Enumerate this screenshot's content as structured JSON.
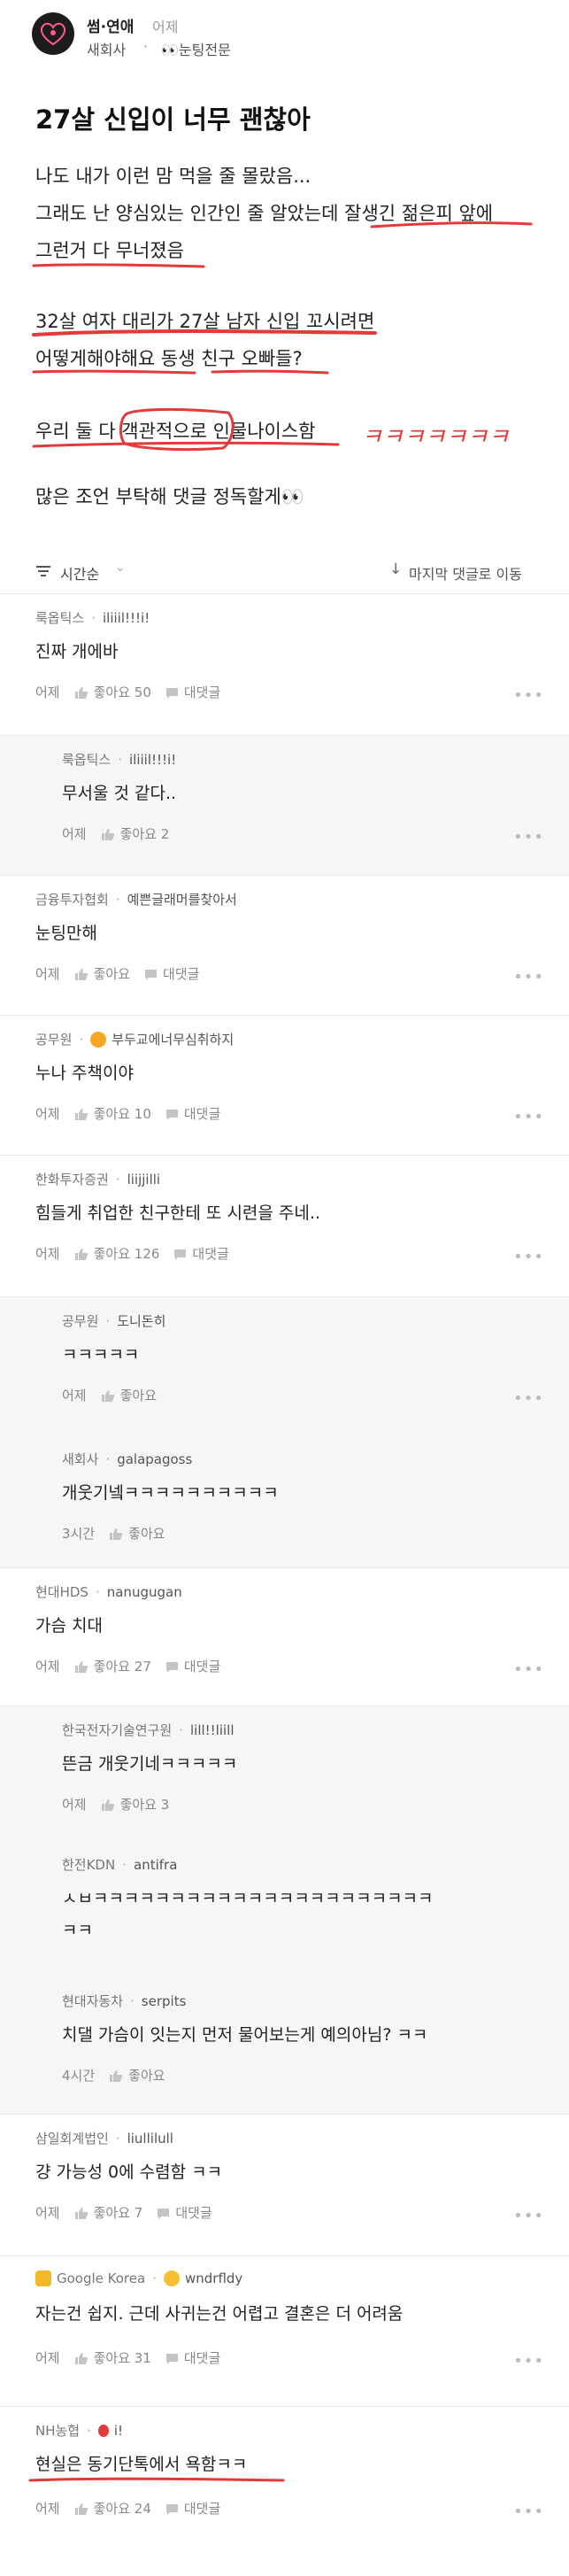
{
  "header": {
    "board_name": "썸·연애",
    "post_time": "어제",
    "author_company": "새회사",
    "author_dot": "·",
    "author_nick": "👀눈팅전문"
  },
  "post": {
    "title": "27살 신입이 너무 괜찮아",
    "lines": [
      "나도 내가 이런 맘 먹을 줄 몰랐음...",
      "그래도 난 양심있는 인간인 줄 알았는데 잘생긴 젊은피 앞에",
      "그런거 다 무너졌음",
      "32살 여자 대리가 27살 남자 신입 꼬시려면",
      "어떻게해야해요 동생 친구 오빠들?",
      "우리 둘 다 객관적으로 인물나이스함",
      "많은 조언 부탁해 댓글 정독할게👀"
    ],
    "handwritten": "ㅋㅋㅋㅋㅋㅋㅋ"
  },
  "sort_bar": {
    "sort_label": "시간순",
    "chevron": "⌄",
    "jump_arrow": "↓",
    "jump_label": "마지막 댓글로 이동"
  },
  "comments": [
    {
      "company": "룩옵틱스",
      "nick": "iliiil!!!i!",
      "text": "진짜 개에바",
      "time": "어제",
      "like": "좋아요 50",
      "reply": "대댓글",
      "more": "•••"
    },
    {
      "company": "룩옵틱스",
      "nick": "iliiil!!!i!",
      "text": "무서울 것 같다..",
      "time": "어제",
      "like": "좋아요 2",
      "more": "•••"
    },
    {
      "company": "금융투자협회",
      "nick": "예쁜글래머를찾아서",
      "text": "눈팅만해",
      "time": "어제",
      "like": "좋아요",
      "reply": "대댓글",
      "more": "•••"
    },
    {
      "company": "공무원",
      "nick": "부두교에너무심취하지",
      "text": "누나 주책이야",
      "time": "어제",
      "like": "좋아요 10",
      "reply": "대댓글",
      "more": "•••"
    },
    {
      "company": "한화투자증권",
      "nick": "liijjilli",
      "text": "힘들게 취업한 친구한테 또 시련을 주네..",
      "time": "어제",
      "like": "좋아요 126",
      "reply": "대댓글",
      "more": "•••"
    },
    {
      "company": "공무원",
      "nick": "도니돈히",
      "text": "ㅋㅋㅋㅋㅋ",
      "time": "어제",
      "like": "좋아요",
      "more": "•••"
    },
    {
      "company": "새회사",
      "nick": "galapagoss",
      "text": "개웃기넼ㅋㅋㅋㅋㅋㅋㅋㅋㅋㅋ",
      "time": "3시간",
      "like": "좋아요"
    },
    {
      "company": "현대HDS",
      "nick": "nanugugan",
      "text": "가슴 치대",
      "time": "어제",
      "like": "좋아요 27",
      "reply": "대댓글",
      "more": "•••"
    },
    {
      "company": "한국전자기술연구원",
      "nick": "lill!!liill",
      "text": "뜬금 개웃기네ㅋㅋㅋㅋㅋ",
      "time": "어제",
      "like": "좋아요 3"
    },
    {
      "company": "한전KDN",
      "nick": "antifra",
      "text": "ㅅㅂㅋㅋㅋㅋㅋㅋㅋㅋㅋㅋㅋㅋㅋㅋㅋㅋㅋㅋㅋㅋㅋㅋ",
      "text2": "ㅋㅋ",
      "time": "",
      "like": ""
    },
    {
      "company": "현대자동차",
      "nick": "serpits",
      "text": "치댈 가슴이 잇는지 먼저 물어보는게 예의아님? ㅋㅋ",
      "time": "4시간",
      "like": "좋아요"
    },
    {
      "company": "삼일회계법인",
      "nick": "liullilull",
      "text": "걍 가능성 0에 수렴함 ㅋㅋ",
      "time": "어제",
      "like": "좋아요 7",
      "reply": "대댓글",
      "more": "•••"
    },
    {
      "company": "Google Korea",
      "nick": "wndrfldy",
      "text": "자는건 쉽지. 근데 사귀는건 어렵고 결혼은 더 어려움",
      "time": "어제",
      "like": "좋아요 31",
      "reply": "대댓글",
      "more": "•••"
    },
    {
      "company": "NH농협",
      "nick": "i!",
      "text": "현실은 동기단톡에서 욕함ㅋㅋ",
      "time": "어제",
      "like": "좋아요 24",
      "reply": "대댓글",
      "more": "•••"
    }
  ]
}
